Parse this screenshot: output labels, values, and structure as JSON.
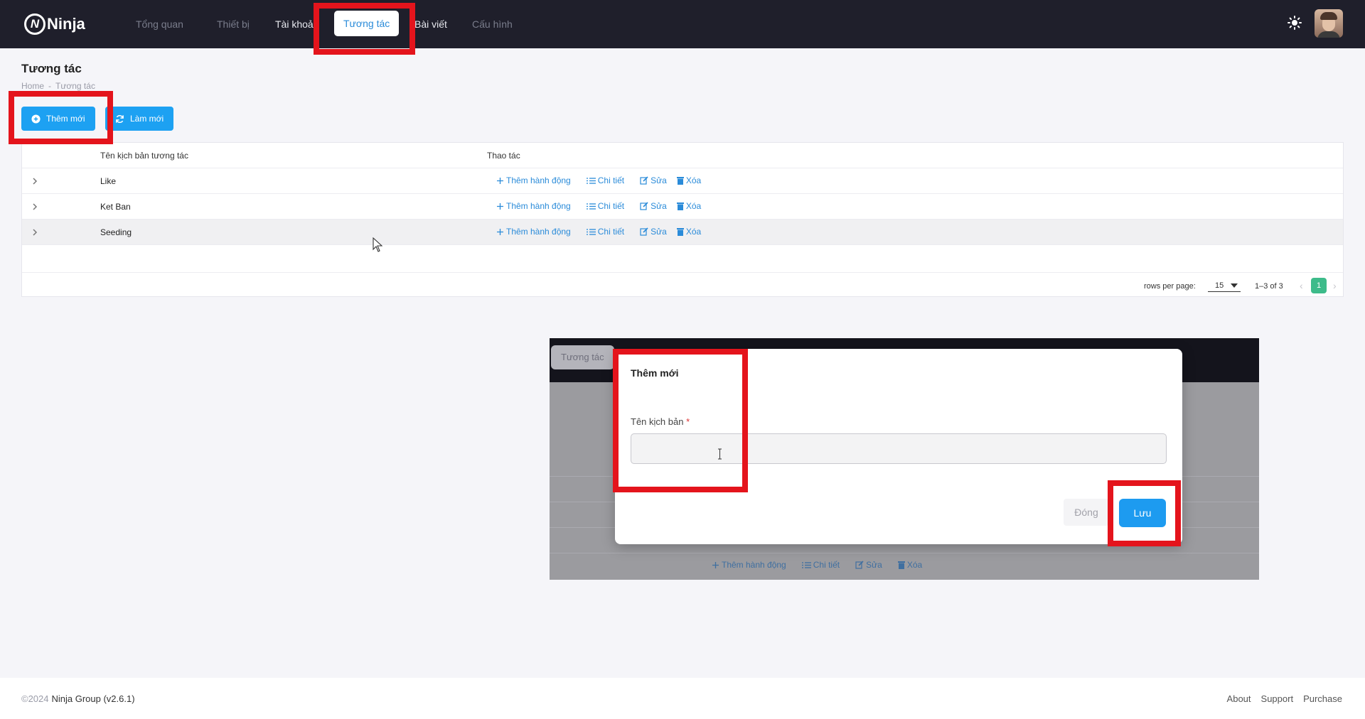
{
  "app": {
    "logo_text": "Ninja",
    "logo_mark": "N"
  },
  "nav": {
    "items": [
      {
        "label": "Tổng quan"
      },
      {
        "label": "Thiết bị"
      },
      {
        "label": "Tài khoản"
      },
      {
        "label": "Tương tác"
      },
      {
        "label": "Bài viết"
      },
      {
        "label": "Cấu hình"
      }
    ],
    "active": "Tương tác"
  },
  "page": {
    "title": "Tương tác",
    "breadcrumb": [
      "Home",
      "Tương tác"
    ],
    "breadcrumb_sep": "-"
  },
  "toolbar": {
    "add_label": "Thêm mới",
    "refresh_label": "Làm mới"
  },
  "table": {
    "columns": [
      "Tên kịch bản tương tác",
      "Thao tác"
    ],
    "rows": [
      {
        "name": "Like"
      },
      {
        "name": "Ket Ban"
      },
      {
        "name": "Seeding"
      }
    ],
    "actions": {
      "add_action": "Thêm hành động",
      "detail": "Chi tiết",
      "edit": "Sửa",
      "delete": "Xóa"
    },
    "footer": {
      "rows_per_page_label": "rows per page:",
      "rows_per_page": "15",
      "range": "1–3 of 3",
      "page": "1"
    }
  },
  "preview": {
    "tab_label": "Tương tác"
  },
  "modal": {
    "title": "Thêm mới",
    "field_label": "Tên kịch bản",
    "required_mark": "*",
    "field_value": "",
    "close_label": "Đóng",
    "save_label": "Lưu"
  },
  "footer": {
    "copyright": "©2024",
    "company": "Ninja Group (v2.6.1)",
    "links": [
      "About",
      "Support",
      "Purchase"
    ]
  },
  "colors": {
    "accent": "#1da1f2",
    "nav_bg": "#1f1f2b",
    "highlight": "#e4141c",
    "page_active": "#3dbb8a"
  }
}
